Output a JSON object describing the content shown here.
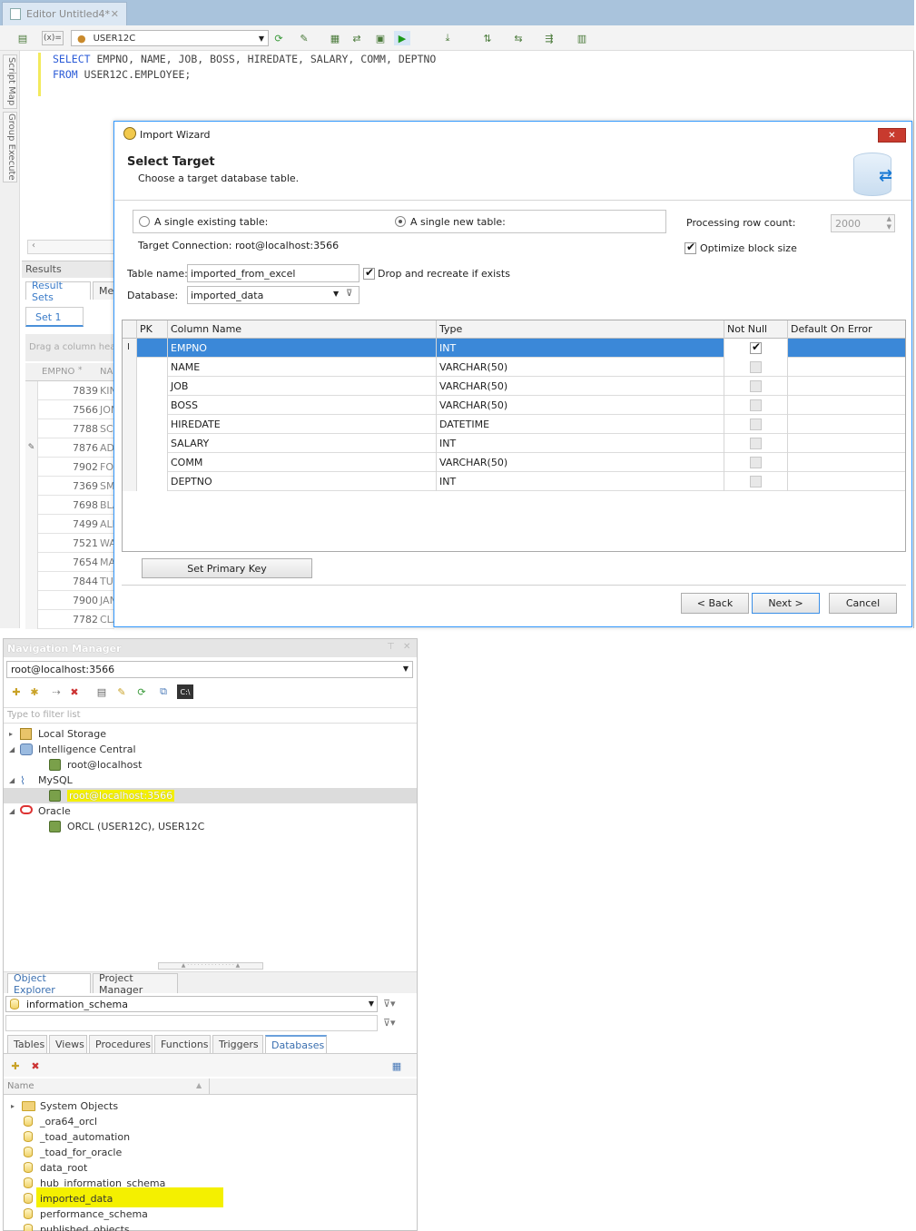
{
  "editor": {
    "tab_title": "Editor Untitled4*",
    "connection": "USER12C",
    "variable_btn": "(x)=",
    "sql_line1_kw": "SELECT",
    "sql_line1_rest": "EMPNO, NAME, JOB, BOSS, HIREDATE, SALARY, COMM, DEPTNO",
    "sql_line2_kw": "FROM",
    "sql_line2_rest": "USER12C.EMPLOYEE;",
    "side_tabs": [
      "Script Map",
      "Group Execute"
    ]
  },
  "results": {
    "title": "Results",
    "tabs": [
      "Result Sets",
      "Mes"
    ],
    "set_tab": "Set 1",
    "group_hint": "Drag a column head",
    "col_empno": "EMPNO",
    "col_name": "NAI",
    "rows": [
      {
        "empno": "7839",
        "name": "KIN"
      },
      {
        "empno": "7566",
        "name": "JON"
      },
      {
        "empno": "7788",
        "name": "SC"
      },
      {
        "empno": "7876",
        "name": "AD"
      },
      {
        "empno": "7902",
        "name": "FO"
      },
      {
        "empno": "7369",
        "name": "SM"
      },
      {
        "empno": "7698",
        "name": "BLA"
      },
      {
        "empno": "7499",
        "name": "ALL"
      },
      {
        "empno": "7521",
        "name": "WA"
      },
      {
        "empno": "7654",
        "name": "MA"
      },
      {
        "empno": "7844",
        "name": "TUI"
      },
      {
        "empno": "7900",
        "name": "JAN"
      },
      {
        "empno": "7782",
        "name": "CLA"
      }
    ]
  },
  "wizard": {
    "title": "Import Wizard",
    "heading": "Select Target",
    "subheading": "Choose a target database table.",
    "radio_existing": "A single existing table:",
    "radio_new": "A single new table:",
    "target_connection": "Target Connection: root@localhost:3566",
    "processing_label": "Processing row count:",
    "processing_value": "2000",
    "optimize_label": "Optimize block size",
    "table_name_label": "Table name:",
    "table_name_value": "imported_from_excel",
    "drop_label": "Drop and recreate if exists",
    "database_label": "Database:",
    "database_value": "imported_data",
    "grid_headers": {
      "pk": "PK",
      "column": "Column Name",
      "type": "Type",
      "notnull": "Not Null",
      "default": "Default On Error"
    },
    "grid_rows": [
      {
        "name": "EMPNO",
        "type": "INT",
        "notnull": true
      },
      {
        "name": "NAME",
        "type": "VARCHAR(50)",
        "notnull": false
      },
      {
        "name": "JOB",
        "type": "VARCHAR(50)",
        "notnull": false
      },
      {
        "name": "BOSS",
        "type": "VARCHAR(50)",
        "notnull": false
      },
      {
        "name": "HIREDATE",
        "type": "DATETIME",
        "notnull": false
      },
      {
        "name": "SALARY",
        "type": "INT",
        "notnull": false
      },
      {
        "name": "COMM",
        "type": "VARCHAR(50)",
        "notnull": false
      },
      {
        "name": "DEPTNO",
        "type": "INT",
        "notnull": false
      }
    ],
    "row_cursor": "I",
    "set_pk_btn": "Set Primary Key",
    "back_btn": "< Back",
    "next_btn": "Next >",
    "cancel_btn": "Cancel",
    "close_glyph": "✕"
  },
  "nav": {
    "title": "Navigation Manager",
    "connection": "root@localhost:3566",
    "filter_placeholder": "Type to filter list",
    "tree": [
      {
        "label": "Local Storage",
        "indent": 0,
        "kind": "group"
      },
      {
        "label": "Intelligence Central",
        "indent": 0,
        "kind": "group"
      },
      {
        "label": "root@localhost",
        "indent": 1,
        "kind": "conn"
      },
      {
        "label": "MySQL",
        "indent": 0,
        "kind": "group"
      },
      {
        "label": "root@localhost:3566",
        "indent": 1,
        "kind": "conn",
        "highlight": true
      },
      {
        "label": "Oracle",
        "indent": 0,
        "kind": "group"
      },
      {
        "label": "ORCL (USER12C), USER12C",
        "indent": 1,
        "kind": "conn"
      }
    ]
  },
  "object_explorer": {
    "tabs": [
      "Object Explorer",
      "Project Manager"
    ],
    "schema": "information_schema",
    "object_tabs": [
      "Tables",
      "Views",
      "Procedures",
      "Functions",
      "Triggers",
      "Databases"
    ],
    "col_name": "Name",
    "items": [
      {
        "label": "System Objects",
        "kind": "folder"
      },
      {
        "label": "_ora64_orcl",
        "kind": "db"
      },
      {
        "label": "_toad_automation",
        "kind": "db"
      },
      {
        "label": "_toad_for_oracle",
        "kind": "db"
      },
      {
        "label": "data_root",
        "kind": "db"
      },
      {
        "label": "hub_information_schema",
        "kind": "db"
      },
      {
        "label": "imported_data",
        "kind": "db",
        "highlight": true
      },
      {
        "label": "performance_schema",
        "kind": "db"
      },
      {
        "label": "published_objects",
        "kind": "db"
      }
    ]
  },
  "colors": {
    "accent": "#3399ff",
    "selection": "#3b88d8",
    "highlight": "#f4f000",
    "keyword": "#2b5bd7"
  }
}
